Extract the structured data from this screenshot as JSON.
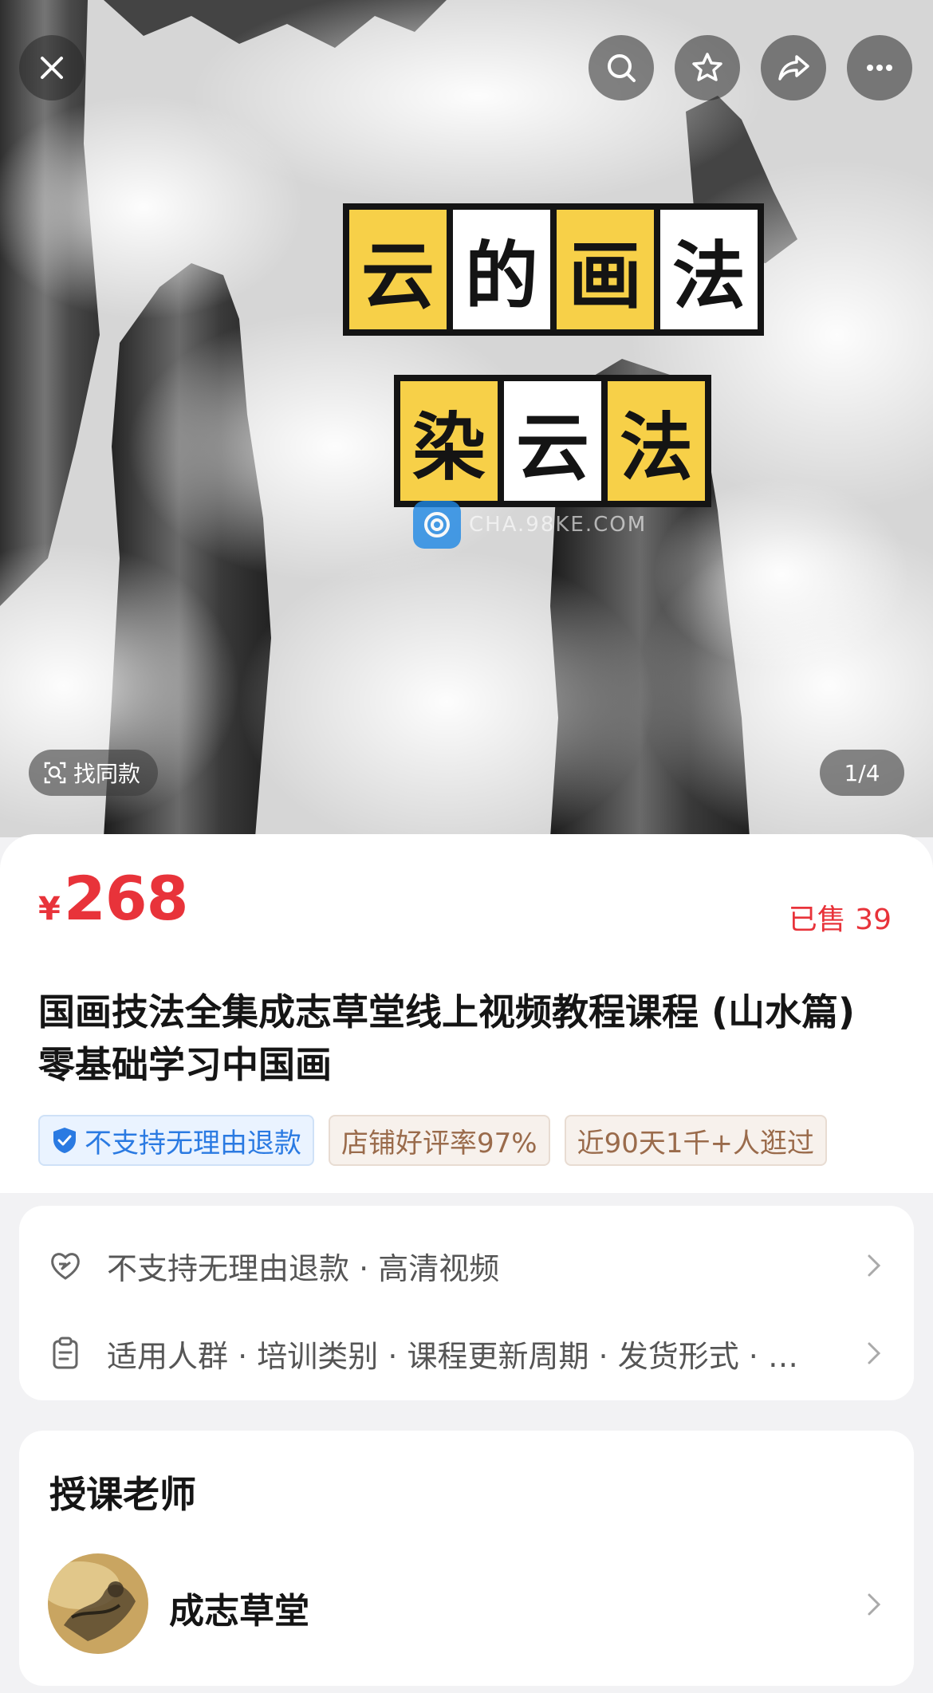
{
  "hero": {
    "title_line1": [
      "云",
      "的",
      "画",
      "法"
    ],
    "title_line2": [
      "染",
      "云",
      "法"
    ],
    "watermark_text": "CHA.98KE.COM",
    "find_same_label": "找同款",
    "image_counter": "1/4"
  },
  "top_bar": {
    "buttons": [
      "close-icon",
      "search-icon",
      "star-icon",
      "share-icon",
      "more-icon"
    ]
  },
  "product": {
    "currency": "¥",
    "price": "268",
    "sold": "已售 39",
    "title": "国画技法全集成志草堂线上视频教程课程 (山水篇) 零基础学习中国画",
    "tags": [
      {
        "text": "不支持无理由退款",
        "style": "blue"
      },
      {
        "text": "店铺好评率97%",
        "style": "brown"
      },
      {
        "text": "近90天1千+人逛过",
        "style": "brown"
      }
    ]
  },
  "service": {
    "row1": "不支持无理由退款 · 高清视频",
    "row2": "适用人群 · 培训类别 · 课程更新周期 · 发货形式 · …"
  },
  "teacher": {
    "heading": "授课老师",
    "name": "成志草堂"
  },
  "colors": {
    "accent_red": "#e8333a",
    "tile_yellow": "#f7d048",
    "tag_blue": "#2a7ae2",
    "tag_brown": "#9a6b4b"
  }
}
